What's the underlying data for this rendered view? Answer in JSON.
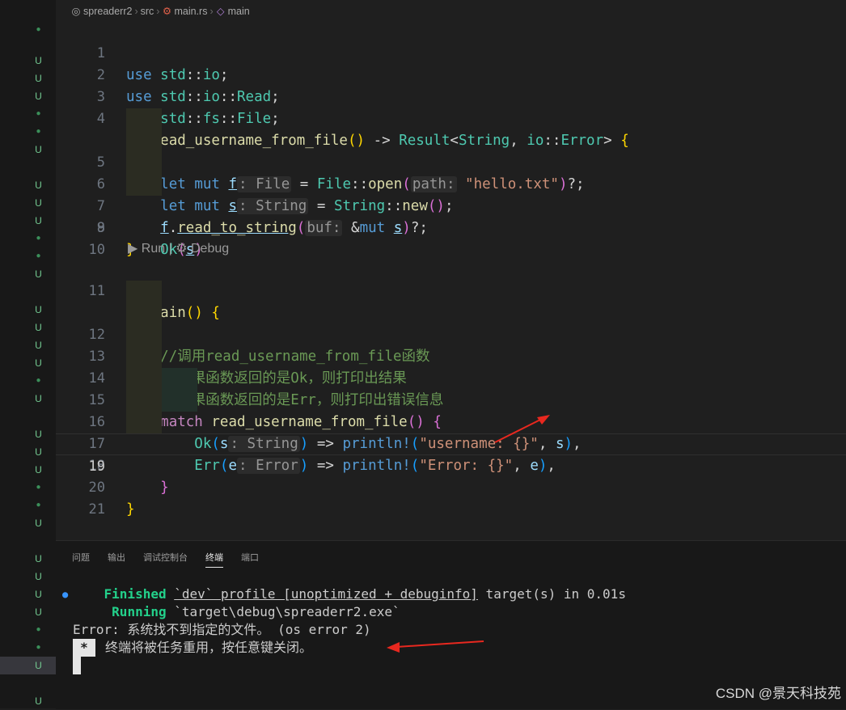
{
  "breadcrumb": {
    "project": "spreaderr2",
    "folder": "src",
    "file": "main.rs",
    "symbol": "main"
  },
  "editor": {
    "codelens": {
      "run": "Run",
      "separator": "|",
      "debug": "Debug"
    },
    "lines": [
      {
        "n": "1"
      },
      {
        "n": "2"
      },
      {
        "n": "3"
      },
      {
        "n": "4"
      },
      {
        "n": "5"
      },
      {
        "n": "6"
      },
      {
        "n": "7"
      },
      {
        "n": "8"
      },
      {
        "n": "9"
      },
      {
        "n": "10"
      },
      {
        "n": "11"
      },
      {
        "n": "12"
      },
      {
        "n": "13"
      },
      {
        "n": "14"
      },
      {
        "n": "15"
      },
      {
        "n": "16"
      },
      {
        "n": "17"
      },
      {
        "n": "18"
      },
      {
        "n": "19"
      },
      {
        "n": "20"
      },
      {
        "n": "21"
      }
    ],
    "comments": {
      "c12": "//调用read_username_from_file函数",
      "c13": "//如果函数返回的是Ok，则打印出结果",
      "c14": "//如果函数返回的是Err，则打印出错误信息"
    },
    "strings": {
      "hello": "\"hello.txt\"",
      "fmt_user": "\"username: {}\"",
      "fmt_err": "\"Error: {}\""
    }
  },
  "panel": {
    "tabs": [
      "问题",
      "输出",
      "调试控制台",
      "终端",
      "端口"
    ],
    "active_tab": "终端",
    "terminal": {
      "finished_label": "Finished",
      "finished_text": "`dev` profile [unoptimized + debuginfo]",
      "finished_tail": " target(s) in 0.01s",
      "running_label": "Running",
      "running_text": "`target\\debug\\spreaderr2.exe`",
      "error_line": "Error: 系统找不到指定的文件。 (os error 2)",
      "prompt_mark": "*",
      "reuse_msg": "终端将被任务重用，按任意键关闭。"
    }
  },
  "watermark": "CSDN @景天科技苑",
  "colors": {
    "accent": "#3794ff",
    "arrow": "#e8281f",
    "git_untracked": "#73c991"
  }
}
